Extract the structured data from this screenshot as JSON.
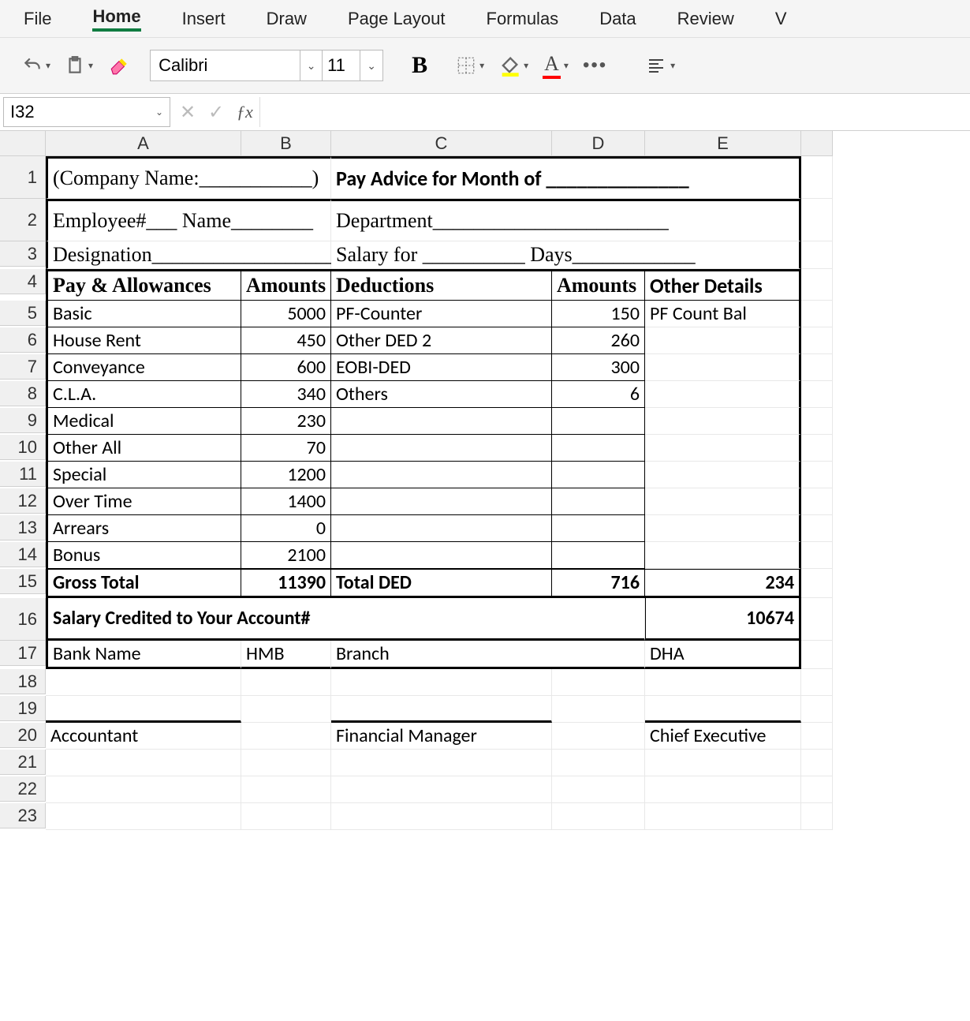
{
  "ribbon": {
    "tabs": [
      "File",
      "Home",
      "Insert",
      "Draw",
      "Page Layout",
      "Formulas",
      "Data",
      "Review",
      "V"
    ],
    "active": "Home"
  },
  "toolbar": {
    "font_name": "Calibri",
    "font_size": "11"
  },
  "namebox": "I32",
  "columns": [
    "A",
    "B",
    "C",
    "D",
    "E"
  ],
  "rows": [
    "1",
    "2",
    "3",
    "4",
    "5",
    "6",
    "7",
    "8",
    "9",
    "10",
    "11",
    "12",
    "13",
    "14",
    "15",
    "16",
    "17",
    "18",
    "19",
    "20",
    "21",
    "22",
    "23"
  ],
  "doc": {
    "r1a": "(Company Name:___________)",
    "r1c": "Pay Advice for Month of ______________",
    "r2a": "Employee#___   Name________",
    "r2c": "Department_______________________",
    "r3a": "Designation__________________",
    "r3c": "Salary for __________ Days____________",
    "hdr": {
      "a": "Pay & Allowances",
      "b": "Amounts",
      "c": "Deductions",
      "d": "Amounts",
      "e": "Other Details"
    },
    "rows": [
      {
        "a": "Basic",
        "b": "5000",
        "c": "PF-Counter",
        "d": "150",
        "e": "PF Count Bal"
      },
      {
        "a": "House Rent",
        "b": "450",
        "c": "Other DED 2",
        "d": "260",
        "e": ""
      },
      {
        "a": "Conveyance",
        "b": "600",
        "c": "EOBI-DED",
        "d": "300",
        "e": ""
      },
      {
        "a": "C.L.A.",
        "b": "340",
        "c": "Others",
        "d": "6",
        "e": ""
      },
      {
        "a": "Medical",
        "b": "230",
        "c": "",
        "d": "",
        "e": ""
      },
      {
        "a": "Other All",
        "b": "70",
        "c": "",
        "d": "",
        "e": ""
      },
      {
        "a": "Special",
        "b": "1200",
        "c": "",
        "d": "",
        "e": ""
      },
      {
        "a": "Over Time",
        "b": "1400",
        "c": "",
        "d": "",
        "e": ""
      },
      {
        "a": "Arrears",
        "b": "0",
        "c": "",
        "d": "",
        "e": ""
      },
      {
        "a": "Bonus",
        "b": "2100",
        "c": "",
        "d": "",
        "e": ""
      }
    ],
    "totals": {
      "a": "Gross Total",
      "b": "11390",
      "c": "Total DED",
      "d": "716",
      "e": "234"
    },
    "credit": {
      "a": "Salary Credited to Your Account#",
      "e": "10674"
    },
    "bank": {
      "a": "Bank Name",
      "b": "HMB",
      "c": "Branch",
      "e": "DHA"
    },
    "sig": {
      "a": "Accountant",
      "c": "Financial Manager",
      "e": "Chief Executive"
    }
  }
}
